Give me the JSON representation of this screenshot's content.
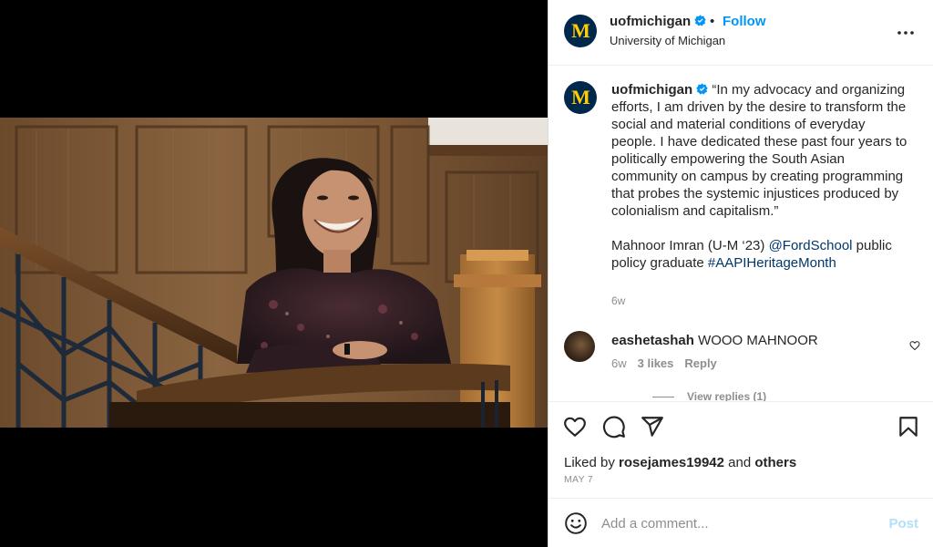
{
  "post": {
    "username": "uofmichigan",
    "follow_label": "Follow",
    "separator": "•",
    "location": "University of Michigan",
    "avatar_letter": "M"
  },
  "caption": {
    "username": "uofmichigan",
    "quote": "“In my advocacy and organizing efforts, I am driven by the desire to transform the social and material conditions of everyday people. I have dedicated these past four years to politically empowering the South Asian community on campus by creating programming that probes the systemic injustices produced by colonialism and capitalism.”",
    "credit_prefix": "Mahnoor Imran (U-M ‘23)",
    "mention": "@FordSchool",
    "credit_middle": "public policy graduate",
    "hashtag": "#AAPIHeritageMonth",
    "time": "6w"
  },
  "comment": {
    "username": "eashetashah",
    "text": "WOOO MAHNOOR",
    "time": "6w",
    "likes": "3 likes",
    "reply_label": "Reply",
    "view_replies": "View replies (1)"
  },
  "actions": {
    "liked_by_prefix": "Liked by",
    "liked_by_user": "rosejames19942",
    "liked_by_and": "and",
    "liked_by_others": "others",
    "date": "MAY 7",
    "icons": [
      "heart-icon",
      "comment-icon",
      "share-icon",
      "bookmark-icon"
    ]
  },
  "composer": {
    "placeholder": "Add a comment...",
    "post_label": "Post"
  },
  "colors": {
    "brand_navy": "#00274c",
    "brand_maize": "#ffcb05",
    "link_blue": "#0095f6",
    "hashtag_blue": "#00376b",
    "muted_gray": "#8e8e8e"
  }
}
